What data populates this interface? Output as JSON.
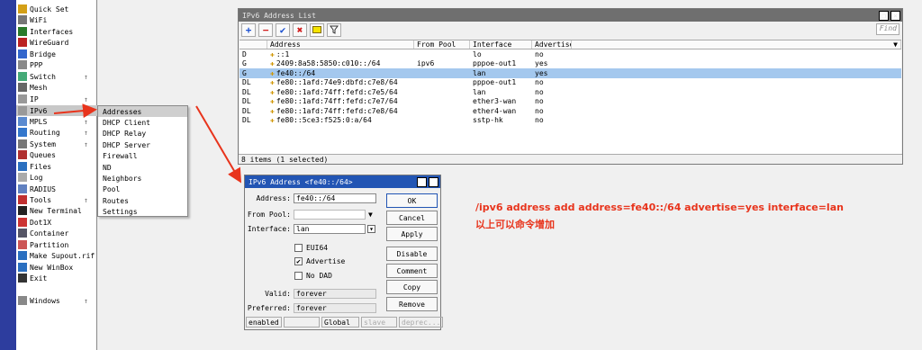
{
  "menu": {
    "items": [
      {
        "label": "Quick Set",
        "icon": "quickset-icon",
        "arrow": ""
      },
      {
        "label": "WiFi",
        "icon": "wifi-icon",
        "arrow": ""
      },
      {
        "label": "Interfaces",
        "icon": "interfaces-icon",
        "arrow": ""
      },
      {
        "label": "WireGuard",
        "icon": "wireguard-icon",
        "arrow": ""
      },
      {
        "label": "Bridge",
        "icon": "bridge-icon",
        "arrow": ""
      },
      {
        "label": "PPP",
        "icon": "ppp-icon",
        "arrow": ""
      },
      {
        "label": "Switch",
        "icon": "switch-icon",
        "arrow": "↑"
      },
      {
        "label": "Mesh",
        "icon": "mesh-icon",
        "arrow": ""
      },
      {
        "label": "IP",
        "icon": "ip-icon",
        "arrow": "↑"
      },
      {
        "label": "IPv6",
        "icon": "ipv6-icon",
        "arrow": ""
      },
      {
        "label": "MPLS",
        "icon": "mpls-icon",
        "arrow": "↑"
      },
      {
        "label": "Routing",
        "icon": "routing-icon",
        "arrow": "↑"
      },
      {
        "label": "System",
        "icon": "system-icon",
        "arrow": "↑"
      },
      {
        "label": "Queues",
        "icon": "queues-icon",
        "arrow": ""
      },
      {
        "label": "Files",
        "icon": "files-icon",
        "arrow": ""
      },
      {
        "label": "Log",
        "icon": "log-icon",
        "arrow": ""
      },
      {
        "label": "RADIUS",
        "icon": "radius-icon",
        "arrow": ""
      },
      {
        "label": "Tools",
        "icon": "tools-icon",
        "arrow": "↑"
      },
      {
        "label": "New Terminal",
        "icon": "terminal-icon",
        "arrow": ""
      },
      {
        "label": "Dot1X",
        "icon": "dot1x-icon",
        "arrow": ""
      },
      {
        "label": "Container",
        "icon": "container-icon",
        "arrow": ""
      },
      {
        "label": "Partition",
        "icon": "partition-icon",
        "arrow": ""
      },
      {
        "label": "Make Supout.rif",
        "icon": "supout-icon",
        "arrow": ""
      },
      {
        "label": "New WinBox",
        "icon": "winbox-icon",
        "arrow": ""
      },
      {
        "label": "Exit",
        "icon": "exit-icon",
        "arrow": ""
      },
      {
        "label": "Windows",
        "icon": "windows-icon",
        "arrow": "↑"
      }
    ]
  },
  "submenu": {
    "items": [
      "Addresses",
      "DHCP Client",
      "DHCP Relay",
      "DHCP Server",
      "Firewall",
      "ND",
      "Neighbors",
      "Pool",
      "Routes",
      "Settings"
    ]
  },
  "list_window": {
    "title": "IPv6 Address List",
    "find_placeholder": "Find",
    "columns": [
      "",
      "Address",
      "From Pool",
      "Interface",
      "Advertise"
    ],
    "rows": [
      {
        "flag": "D",
        "address": "::1",
        "pool": "",
        "iface": "lo",
        "adv": "no",
        "selected": false
      },
      {
        "flag": "G",
        "address": "2409:8a58:5850:c010::/64",
        "pool": "ipv6",
        "iface": "pppoe-out1",
        "adv": "yes",
        "selected": false
      },
      {
        "flag": "G",
        "address": "fe40::/64",
        "pool": "",
        "iface": "lan",
        "adv": "yes",
        "selected": true
      },
      {
        "flag": "DL",
        "address": "fe80::1afd:74e9:dbfd:c7e8/64",
        "pool": "",
        "iface": "pppoe-out1",
        "adv": "no",
        "selected": false
      },
      {
        "flag": "DL",
        "address": "fe80::1afd:74ff:fefd:c7e5/64",
        "pool": "",
        "iface": "lan",
        "adv": "no",
        "selected": false
      },
      {
        "flag": "DL",
        "address": "fe80::1afd:74ff:fefd:c7e7/64",
        "pool": "",
        "iface": "ether3-wan",
        "adv": "no",
        "selected": false
      },
      {
        "flag": "DL",
        "address": "fe80::1afd:74ff:fefd:c7e8/64",
        "pool": "",
        "iface": "ether4-wan",
        "adv": "no",
        "selected": false
      },
      {
        "flag": "DL",
        "address": "fe80::5ce3:f525:0:a/64",
        "pool": "",
        "iface": "sstp-hk",
        "adv": "no",
        "selected": false
      }
    ],
    "status": "8 items (1 selected)"
  },
  "dialog": {
    "title": "IPv6 Address <fe40::/64>",
    "address_label": "Address:",
    "address_value": "fe40::/64",
    "from_pool_label": "From Pool:",
    "from_pool_value": "",
    "interface_label": "Interface:",
    "interface_value": "lan",
    "eui64_label": "EUI64",
    "advertise_label": "Advertise",
    "no_dad_label": "No DAD",
    "valid_label": "Valid:",
    "valid_value": "forever",
    "preferred_label": "Preferred:",
    "preferred_value": "forever",
    "buttons": [
      "OK",
      "Cancel",
      "Apply",
      "Disable",
      "Comment",
      "Copy",
      "Remove"
    ],
    "status": [
      "enabled",
      "",
      "Global",
      "slave",
      "deprec..."
    ]
  },
  "annotation": {
    "command": "/ipv6 address add address=fe40::/64 advertise=yes interface=lan",
    "note": "以上可以命令增加",
    "color": "#e8341c"
  }
}
